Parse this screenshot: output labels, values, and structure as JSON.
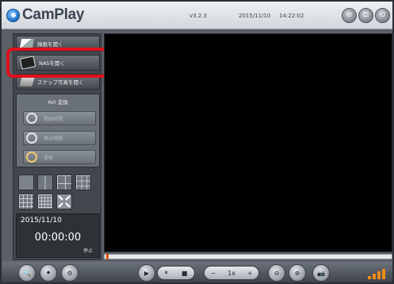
{
  "app": {
    "title": "CamPlay",
    "version": "v3.2.3",
    "date": "2015/11/10",
    "time": "14:22:02"
  },
  "window_buttons": [
    {
      "icon": "minimize-icon",
      "glyph": "⊖"
    },
    {
      "icon": "restore-icon",
      "glyph": "⊡"
    },
    {
      "icon": "power-icon",
      "glyph": "⏻"
    }
  ],
  "sidebar": {
    "items": [
      {
        "label": "録画を開く",
        "icon": "video-file-icon"
      },
      {
        "label": "NASを開く",
        "icon": "nas-icon"
      },
      {
        "label": "スナップ写真を開く",
        "icon": "snapshot-icon"
      }
    ],
    "avi": {
      "title": "AVI 変換",
      "buttons": [
        {
          "label": "開始時間",
          "icon": "clock-start-icon"
        },
        {
          "label": "停止時間",
          "icon": "clock-stop-icon"
        },
        {
          "label": "変換",
          "icon": "convert-globe-icon"
        }
      ]
    },
    "layout_icons": [
      "single-view-icon",
      "quad-view-icon",
      "six-view-icon",
      "nine-view-icon",
      "sixteen-view-icon",
      "grid-view-icon",
      "fullscreen-icon"
    ],
    "playback": {
      "date": "2015/11/10",
      "time": "00:00:00",
      "status": "停止"
    }
  },
  "progress": {
    "value": 0.0
  },
  "controls": {
    "speed": "1x",
    "minus_label": "−",
    "plus_label": "+"
  },
  "colors": {
    "accent": "#f08a16",
    "highlight": "#e0101a",
    "video_bg": "#000000"
  }
}
